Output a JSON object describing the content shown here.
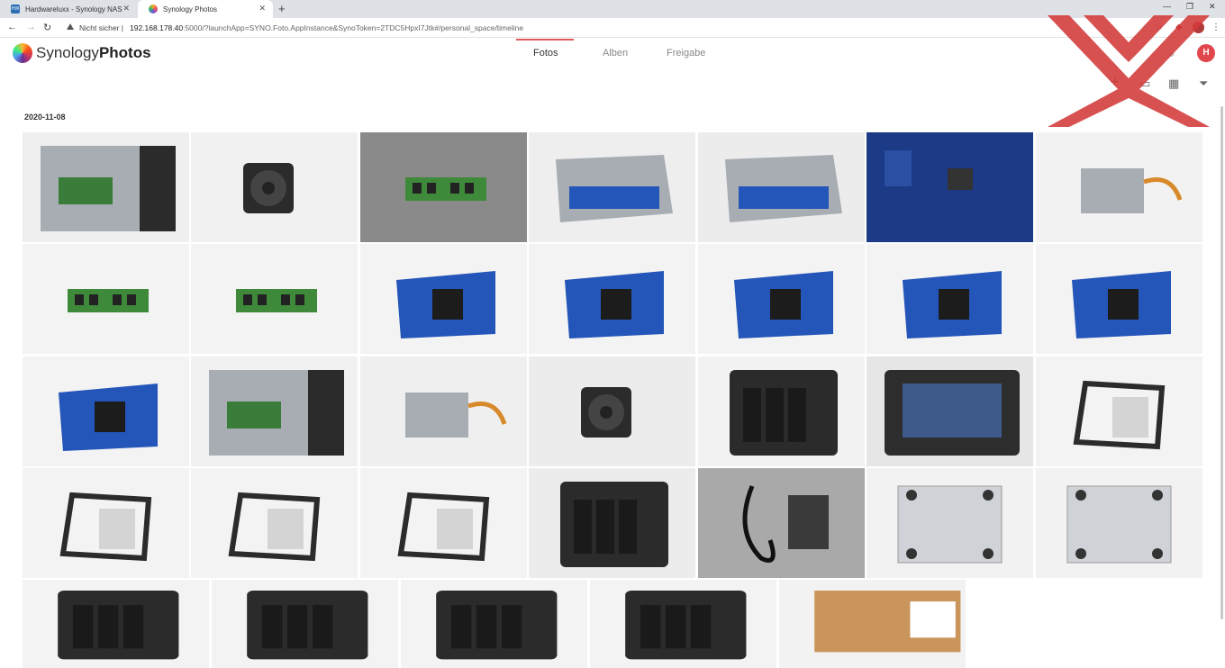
{
  "browser": {
    "tabs": [
      {
        "label": "Hardwareluxx - Synology NAS",
        "active": false,
        "favicon": "hardwareluxx-favicon"
      },
      {
        "label": "Synology Photos",
        "active": true,
        "favicon": "synology-photos-favicon"
      }
    ],
    "security_label": "Nicht sicher",
    "url_host": "192.168.178.40",
    "url_rest": ":5000/?launchApp=SYNO.Foto.AppInstance&SynoToken=2TDC5HpxI7Jtk#/personal_space/timeline"
  },
  "app": {
    "brand_light": "Synology",
    "brand_bold": "Photos",
    "nav": [
      "Fotos",
      "Alben",
      "Freigabe"
    ],
    "active_nav": "Fotos",
    "avatar_initial": "H",
    "accent_color": "#e0474c"
  },
  "timeline": {
    "date": "2020-11-08",
    "photos": [
      {
        "subject": "nas-open-side-pcie-card",
        "bg": "#efefef"
      },
      {
        "subject": "case-fan",
        "bg": "#f1f1f1"
      },
      {
        "subject": "front-frame-closeup",
        "bg": "#8a8a8a"
      },
      {
        "subject": "rear-io-board-cage",
        "bg": "#eeeeee"
      },
      {
        "subject": "drive-cage-metal",
        "bg": "#ececec"
      },
      {
        "subject": "mainboard-closeup",
        "bg": "#1f3f8c"
      },
      {
        "subject": "power-supply-unit",
        "bg": "#f2f2f2"
      },
      {
        "subject": "ram-module",
        "bg": "#f3f3f3"
      },
      {
        "subject": "ram-module",
        "bg": "#f3f3f3"
      },
      {
        "subject": "m2-adapter-board",
        "bg": "#f3f3f3"
      },
      {
        "subject": "sata-backplane",
        "bg": "#f3f3f3"
      },
      {
        "subject": "sata-backplane",
        "bg": "#f3f3f3"
      },
      {
        "subject": "mainboard-heatsink",
        "bg": "#f3f3f3"
      },
      {
        "subject": "mainboard-back",
        "bg": "#f3f3f3"
      },
      {
        "subject": "mainboard-angled",
        "bg": "#f3f3f3"
      },
      {
        "subject": "nas-open-side",
        "bg": "#f1f1f1"
      },
      {
        "subject": "nas-psu-side",
        "bg": "#efefef"
      },
      {
        "subject": "nas-rear-fans",
        "bg": "#ececec"
      },
      {
        "subject": "nas-rear-screwdriver",
        "bg": "#f2f2f2"
      },
      {
        "subject": "nas-empty-bays",
        "bg": "#e6e6e6"
      },
      {
        "subject": "drive-tray-with-disk",
        "bg": "#f3f3f3"
      },
      {
        "subject": "drive-tray-with-disk",
        "bg": "#f3f3f3"
      },
      {
        "subject": "hdd-on-tray-rail",
        "bg": "#f3f3f3"
      },
      {
        "subject": "empty-drive-tray",
        "bg": "#f3f3f3"
      },
      {
        "subject": "nas-front-angled",
        "bg": "#ececec"
      },
      {
        "subject": "power-cable-and-manual",
        "bg": "#a9a9a9"
      },
      {
        "subject": "nas-bottom-open",
        "bg": "#f2f2f2"
      },
      {
        "subject": "nas-bottom",
        "bg": "#f2f2f2"
      },
      {
        "subject": "nas-rear",
        "bg": "#f3f3f3"
      },
      {
        "subject": "nas-top-logo",
        "bg": "#f3f3f3"
      },
      {
        "subject": "nas-top-logo",
        "bg": "#f3f3f3"
      },
      {
        "subject": "nas-front-bays",
        "bg": "#f3f3f3"
      },
      {
        "subject": "retail-box",
        "bg": "#f2f2f2"
      }
    ]
  }
}
